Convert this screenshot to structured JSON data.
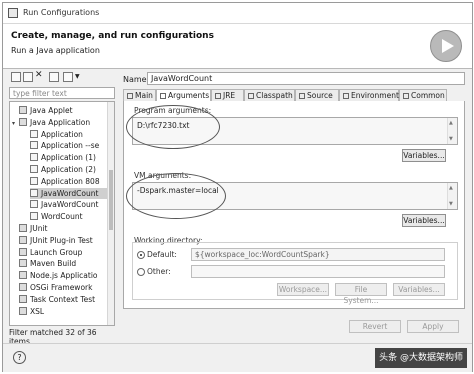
{
  "window": {
    "title": "Run Configurations"
  },
  "banner": {
    "heading": "Create, manage, and run configurations",
    "subtitle": "Run a Java application"
  },
  "left": {
    "filter_placeholder": "type filter text",
    "tree": [
      {
        "label": "Java Applet",
        "level": 1,
        "icon": "java-applet-icon"
      },
      {
        "label": "Java Application",
        "level": 1,
        "icon": "java-application-icon",
        "expanded": true
      },
      {
        "label": "Application",
        "level": 2
      },
      {
        "label": "Application --se",
        "level": 2
      },
      {
        "label": "Application (1)",
        "level": 2
      },
      {
        "label": "Application (2)",
        "level": 2
      },
      {
        "label": "Application 808",
        "level": 2
      },
      {
        "label": "JavaWordCount",
        "level": 2,
        "selected": true
      },
      {
        "label": "JavaWordCount",
        "level": 2
      },
      {
        "label": "WordCount",
        "level": 2
      },
      {
        "label": "JUnit",
        "level": 1
      },
      {
        "label": "JUnit Plug-in Test",
        "level": 1
      },
      {
        "label": "Launch Group",
        "level": 1
      },
      {
        "label": "Maven Build",
        "level": 1
      },
      {
        "label": "Node.js Applicatio",
        "level": 1
      },
      {
        "label": "OSGi Framework",
        "level": 1
      },
      {
        "label": "Task Context Test",
        "level": 1
      },
      {
        "label": "XSL",
        "level": 1
      }
    ],
    "footer": "Filter matched 32 of 36 items"
  },
  "right": {
    "name_label": "Name:",
    "name_value": "JavaWordCount",
    "tabs": [
      "Main",
      "Arguments",
      "JRE",
      "Classpath",
      "Source",
      "Environment",
      "Common"
    ],
    "program_args_label": "Program arguments:",
    "program_args_value": "D:\\rfc7230.txt",
    "vm_args_label": "VM arguments:",
    "vm_args_value": "-Dspark.master=local",
    "variables_label": "Variables...",
    "working_dir_label": "Working directory:",
    "default_label": "Default:",
    "default_value": "${workspace_loc:WordCountSpark}",
    "other_label": "Other:",
    "workspace_btn": "Workspace...",
    "filesystem_btn": "File System...",
    "revert_btn": "Revert",
    "apply_btn": "Apply"
  },
  "bottom": {
    "watermark": "头条 @大数据架构师"
  }
}
